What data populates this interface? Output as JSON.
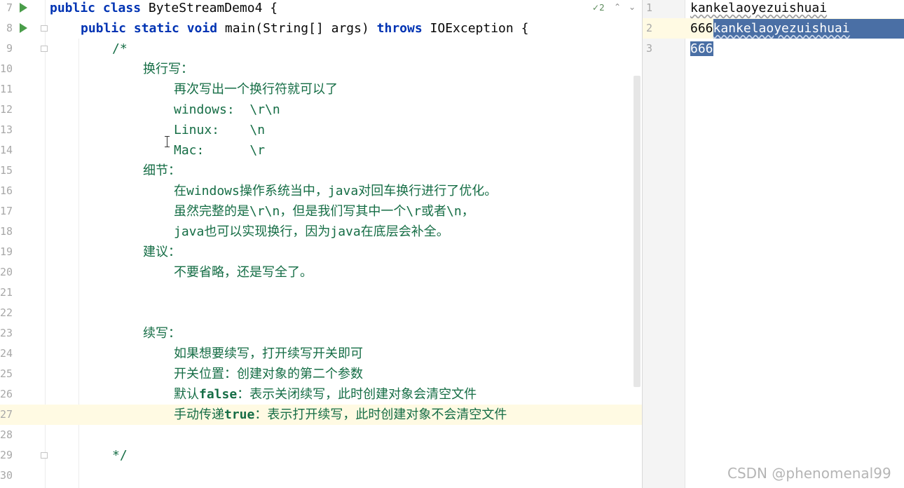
{
  "editor": {
    "line_numbers": [
      "7",
      "8",
      "9",
      "10",
      "11",
      "12",
      "13",
      "14",
      "15",
      "16",
      "17",
      "18",
      "19",
      "20",
      "21",
      "22",
      "23",
      "24",
      "25",
      "26",
      "27",
      "28",
      "29",
      "30"
    ],
    "inspection_count": "2",
    "inspection_icon": "check-icon",
    "code": {
      "l7_kw": "public class",
      "l7_rest": " ByteStreamDemo4 {",
      "l8_kw1": "public static void",
      "l8_mid": " main(String[] args) ",
      "l8_kw2": "throws",
      "l8_rest": " IOException {",
      "l9": "/*",
      "l10": "换行写：",
      "l11": "再次写出一个换行符就可以了",
      "l12": "windows:  \\r\\n",
      "l13": "Linux:    \\n",
      "l14": "Mac:      \\r",
      "l15": "细节：",
      "l16_a": "在",
      "l16_b": "windows",
      "l16_c": "操作系统当中，",
      "l16_d": "java",
      "l16_e": "对回车换行进行了优化。",
      "l17_a": "虽然完整的是",
      "l17_b": "\\r\\n",
      "l17_c": "，但是我们写其中一个",
      "l17_d": "\\r",
      "l17_e": "或者",
      "l17_f": "\\n",
      "l17_g": "，",
      "l18_a": "java",
      "l18_b": "也可以实现换行，因为",
      "l18_c": "java",
      "l18_d": "在底层会补全。",
      "l19": "建议：",
      "l20": "不要省略，还是写全了。",
      "l23": "续写：",
      "l24": "如果想要续写，打开续写开关即可",
      "l25": "开关位置：创建对象的第二个参数",
      "l26_a": "默认",
      "l26_b": "false",
      "l26_c": "：表示关闭续写，此时创建对象会清空文件",
      "l27_a": "手动传递",
      "l27_b": "true",
      "l27_c": "：表示打开续写，此时创建对象不会清空文件",
      "l29": "*/"
    }
  },
  "output_file": {
    "line_numbers": [
      "1",
      "2",
      "3"
    ],
    "lines": {
      "l1": "kankelaoyezuishuai",
      "l2_prefix": "666",
      "l2_selected": "kankelaoyezuishuai",
      "l3_selected": "666"
    }
  },
  "watermark": "CSDN @phenomenal99",
  "colors": {
    "keyword": "#0033b3",
    "comment": "#156d45",
    "selection": "#4a6fa5",
    "current_line": "#fffae3"
  }
}
